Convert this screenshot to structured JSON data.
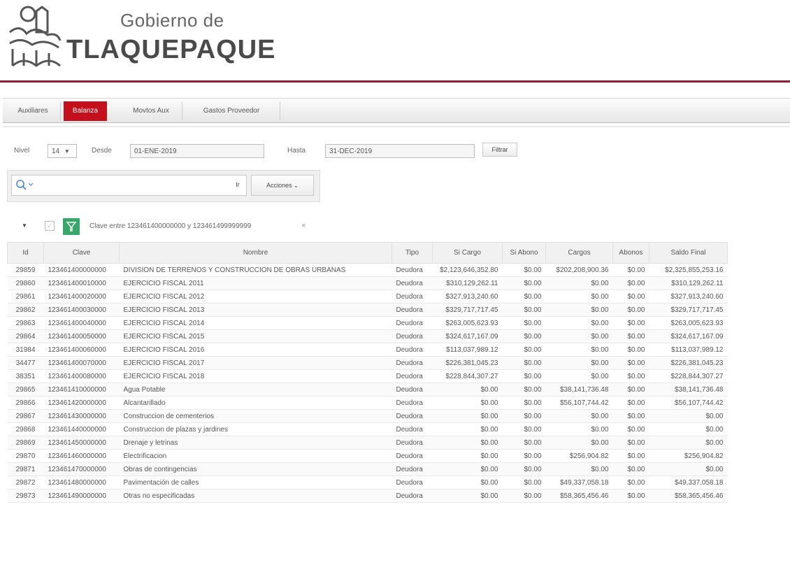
{
  "header": {
    "gov_prefix": "Gobierno de",
    "gov_name": "TLAQUEPAQUE"
  },
  "tabs": [
    {
      "label": "Auxiliares",
      "active": false
    },
    {
      "label": "Balanza",
      "active": true
    },
    {
      "label": "Movtos Aux",
      "active": false
    },
    {
      "label": "Gastos Proveedor",
      "active": false
    }
  ],
  "filters": {
    "nivel_label": "Nivel",
    "nivel_value": "14",
    "desde_label": "Desde",
    "desde_value": "01-ENE-2019",
    "hasta_label": "Hasta",
    "hasta_value": "31-DEC-2019",
    "filter_button": "Filtrar"
  },
  "search": {
    "go_button": "Ir",
    "actions_button": "Acciones"
  },
  "active_filter": {
    "text": "Clave entre 123461400000000 y 123461499999999"
  },
  "colors": {
    "accent": "#c4101c",
    "brand_line": "#8a1e36",
    "filter_icon": "#3aa66b"
  },
  "table": {
    "headers": [
      "Id",
      "Clave",
      "Nombre",
      "Tipo",
      "Si Cargo",
      "Si Abono",
      "Cargos",
      "Abonos",
      "Saldo Final"
    ],
    "rows": [
      [
        "29859",
        "123461400000000",
        "DIVISION DE TERRENOS Y CONSTRUCCION DE OBRAS URBANAS",
        "Deudora",
        "$2,123,646,352.80",
        "$0.00",
        "$202,208,900.36",
        "$0.00",
        "$2,325,855,253.16"
      ],
      [
        "29860",
        "123461400010000",
        "EJERCICIO FISCAL 2011",
        "Deudora",
        "$310,129,262.11",
        "$0.00",
        "$0.00",
        "$0.00",
        "$310,129,262.11"
      ],
      [
        "29861",
        "123461400020000",
        "EJERCICIO FISCAL 2012",
        "Deudora",
        "$327,913,240.60",
        "$0.00",
        "$0.00",
        "$0.00",
        "$327,913,240.60"
      ],
      [
        "29862",
        "123461400030000",
        "EJERCICIO FISCAL 2013",
        "Deudora",
        "$329,717,717.45",
        "$0.00",
        "$0.00",
        "$0.00",
        "$329,717,717.45"
      ],
      [
        "29863",
        "123461400040000",
        "EJERCICIO FISCAL 2014",
        "Deudora",
        "$263,005,623.93",
        "$0.00",
        "$0.00",
        "$0.00",
        "$263,005,623.93"
      ],
      [
        "29864",
        "123461400050000",
        "EJERCICIO FISCAL 2015",
        "Deudora",
        "$324,617,167.09",
        "$0.00",
        "$0.00",
        "$0.00",
        "$324,617,167.09"
      ],
      [
        "31984",
        "123461400060000",
        "EJERCICIO FISCAL 2016",
        "Deudora",
        "$113,037,989.12",
        "$0.00",
        "$0.00",
        "$0.00",
        "$113,037,989.12"
      ],
      [
        "34477",
        "123461400070000",
        "EJERCICIO FISCAL 2017",
        "Deudora",
        "$226,381,045.23",
        "$0.00",
        "$0.00",
        "$0.00",
        "$226,381,045.23"
      ],
      [
        "38351",
        "123461400080000",
        "EJERCICIO FISCAL 2018",
        "Deudora",
        "$228,844,307.27",
        "$0.00",
        "$0.00",
        "$0.00",
        "$228,844,307.27"
      ],
      [
        "29865",
        "123461410000000",
        "Agua Potable",
        "Deudora",
        "$0.00",
        "$0.00",
        "$38,141,736.48",
        "$0.00",
        "$38,141,736.48"
      ],
      [
        "29866",
        "123461420000000",
        "Alcantarillado",
        "Deudora",
        "$0.00",
        "$0.00",
        "$56,107,744.42",
        "$0.00",
        "$56,107,744.42"
      ],
      [
        "29867",
        "123461430000000",
        "Construccion de cementerios",
        "Deudora",
        "$0.00",
        "$0.00",
        "$0.00",
        "$0.00",
        "$0.00"
      ],
      [
        "29868",
        "123461440000000",
        "Construccion de plazas y jardines",
        "Deudora",
        "$0.00",
        "$0.00",
        "$0.00",
        "$0.00",
        "$0.00"
      ],
      [
        "29869",
        "123461450000000",
        "Drenaje y letrinas",
        "Deudora",
        "$0.00",
        "$0.00",
        "$0.00",
        "$0.00",
        "$0.00"
      ],
      [
        "29870",
        "123461460000000",
        "Electrificacion",
        "Deudora",
        "$0.00",
        "$0.00",
        "$256,904.82",
        "$0.00",
        "$256,904.82"
      ],
      [
        "29871",
        "123461470000000",
        "Obras de contingencias",
        "Deudora",
        "$0.00",
        "$0.00",
        "$0.00",
        "$0.00",
        "$0.00"
      ],
      [
        "29872",
        "123461480000000",
        "Pavimentación de calles",
        "Deudora",
        "$0.00",
        "$0.00",
        "$49,337,058.18",
        "$0.00",
        "$49,337,058.18"
      ],
      [
        "29873",
        "123461490000000",
        "Otras no especificadas",
        "Deudora",
        "$0.00",
        "$0.00",
        "$58,365,456.46",
        "$0.00",
        "$58,365,456.46"
      ]
    ]
  }
}
